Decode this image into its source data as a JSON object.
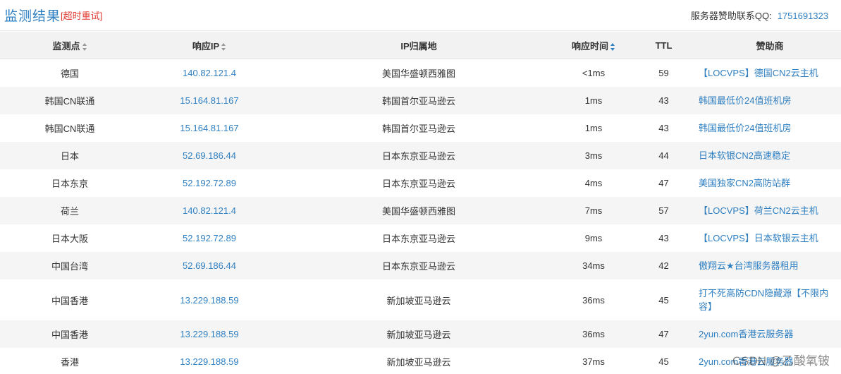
{
  "header": {
    "title": "监测结果",
    "retry_label": "[超时重试]",
    "contact_label": "服务器赞助联系QQ:",
    "contact_qq": "1751691323"
  },
  "table": {
    "columns": [
      "监测点",
      "响应IP",
      "IP归属地",
      "响应时间",
      "TTL",
      "赞助商"
    ],
    "rows": [
      {
        "node": "德国",
        "ip": "140.82.121.4",
        "location": "美国华盛顿西雅图",
        "time": "<1ms",
        "ttl": "59",
        "sponsor": "【LOCVPS】德国CN2云主机"
      },
      {
        "node": "韩国CN联通",
        "ip": "15.164.81.167",
        "location": "韩国首尔亚马逊云",
        "time": "1ms",
        "ttl": "43",
        "sponsor": "韩国最低价24值班机房"
      },
      {
        "node": "韩国CN联通",
        "ip": "15.164.81.167",
        "location": "韩国首尔亚马逊云",
        "time": "1ms",
        "ttl": "43",
        "sponsor": "韩国最低价24值班机房"
      },
      {
        "node": "日本",
        "ip": "52.69.186.44",
        "location": "日本东京亚马逊云",
        "time": "3ms",
        "ttl": "44",
        "sponsor": "日本软银CN2高速稳定"
      },
      {
        "node": "日本东京",
        "ip": "52.192.72.89",
        "location": "日本东京亚马逊云",
        "time": "4ms",
        "ttl": "47",
        "sponsor": "美国独家CN2高防站群"
      },
      {
        "node": "荷兰",
        "ip": "140.82.121.4",
        "location": "美国华盛顿西雅图",
        "time": "7ms",
        "ttl": "57",
        "sponsor": "【LOCVPS】荷兰CN2云主机"
      },
      {
        "node": "日本大阪",
        "ip": "52.192.72.89",
        "location": "日本东京亚马逊云",
        "time": "9ms",
        "ttl": "43",
        "sponsor": "【LOCVPS】日本软银云主机"
      },
      {
        "node": "中国台湾",
        "ip": "52.69.186.44",
        "location": "日本东京亚马逊云",
        "time": "34ms",
        "ttl": "42",
        "sponsor": "傲翔云★台湾服务器租用"
      },
      {
        "node": "中国香港",
        "ip": "13.229.188.59",
        "location": "新加坡亚马逊云",
        "time": "36ms",
        "ttl": "45",
        "sponsor": "打不死高防CDN隐藏源【不限内容】"
      },
      {
        "node": "中国香港",
        "ip": "13.229.188.59",
        "location": "新加坡亚马逊云",
        "time": "36ms",
        "ttl": "47",
        "sponsor": "2yun.com香港云服务器"
      },
      {
        "node": "香港",
        "ip": "13.229.188.59",
        "location": "新加坡亚马逊云",
        "time": "37ms",
        "ttl": "45",
        "sponsor": "2yun.com香港云服务器"
      }
    ]
  },
  "watermark": "CSDN @乙酸氧铍",
  "colors": {
    "accent": "#2f7fc1",
    "retry": "#e0392f",
    "header_bg": "#f2f2f2",
    "stripe": "#f5f5f5"
  }
}
